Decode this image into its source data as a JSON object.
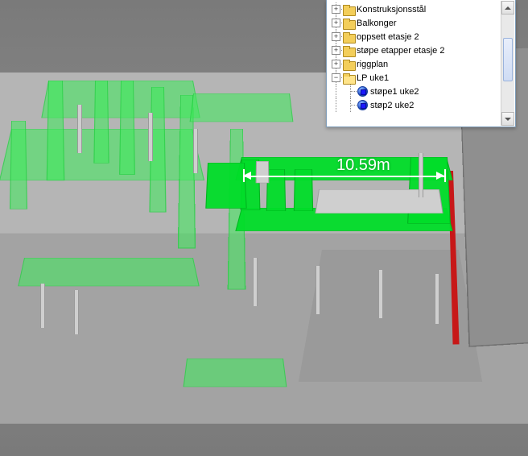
{
  "dimension": {
    "value": "10.59m"
  },
  "tree": {
    "items": [
      {
        "label": "Konstruksjonsstål",
        "kind": "folder",
        "expanded": false,
        "depth": 1
      },
      {
        "label": "Balkonger",
        "kind": "folder",
        "expanded": false,
        "depth": 1
      },
      {
        "label": "oppsett etasje 2",
        "kind": "folder",
        "expanded": false,
        "depth": 1
      },
      {
        "label": "støpe etapper etasje 2",
        "kind": "folder",
        "expanded": false,
        "depth": 1
      },
      {
        "label": "riggplan",
        "kind": "folder",
        "expanded": false,
        "depth": 1
      },
      {
        "label": "LP uke1",
        "kind": "folder",
        "expanded": true,
        "depth": 1
      },
      {
        "label": "støpe1 uke2",
        "kind": "node",
        "expanded": null,
        "depth": 2
      },
      {
        "label": "støp2 uke2",
        "kind": "node",
        "expanded": null,
        "depth": 2
      }
    ]
  }
}
